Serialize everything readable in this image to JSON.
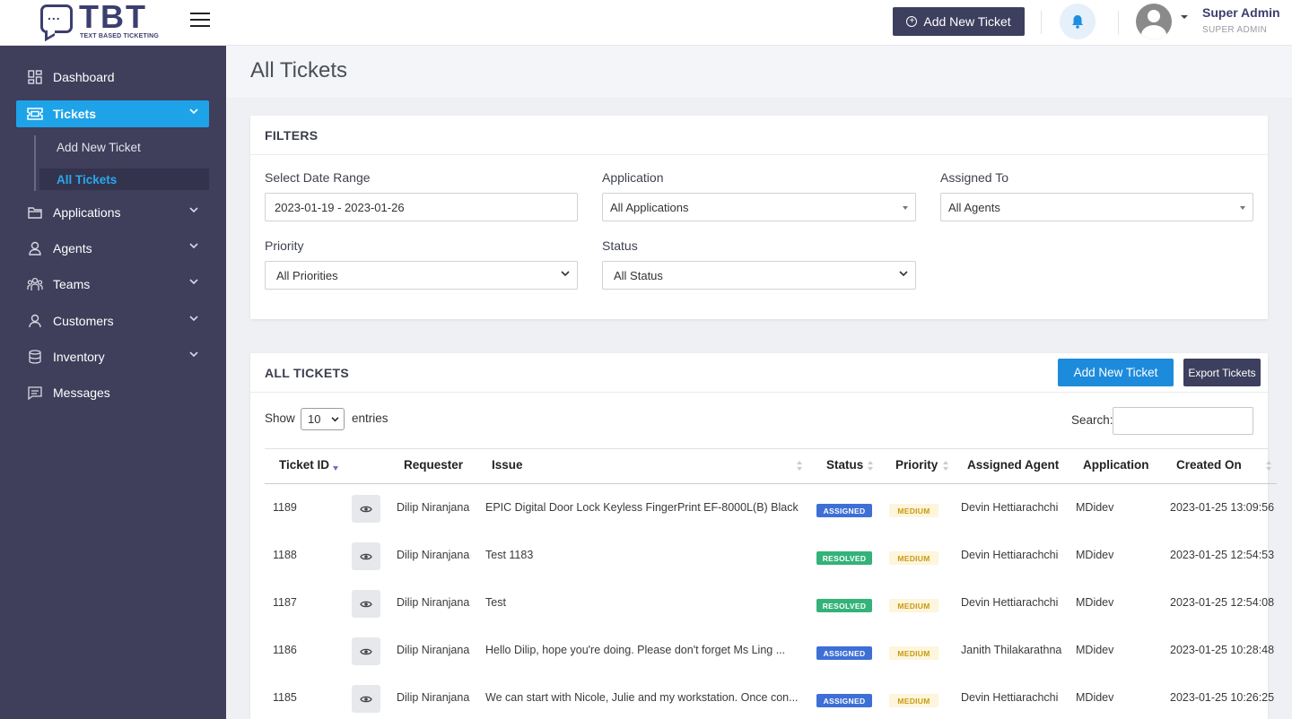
{
  "brand": {
    "name": "TBT",
    "tagline": "TEXT BASED TICKETING",
    "dots": "..."
  },
  "topbar": {
    "add_ticket_label": "Add New Ticket",
    "user_name": "Super Admin",
    "user_role": "SUPER ADMIN"
  },
  "sidebar": {
    "items": [
      {
        "label": "Dashboard",
        "icon": "dashboard-icon"
      },
      {
        "label": "Tickets",
        "icon": "ticket-icon",
        "active": true
      },
      {
        "label": "Applications",
        "icon": "folder-icon"
      },
      {
        "label": "Agents",
        "icon": "user-icon"
      },
      {
        "label": "Teams",
        "icon": "team-icon"
      },
      {
        "label": "Customers",
        "icon": "user-icon"
      },
      {
        "label": "Inventory",
        "icon": "database-icon"
      },
      {
        "label": "Messages",
        "icon": "message-icon"
      }
    ],
    "ticket_sub": [
      {
        "label": "Add New Ticket"
      },
      {
        "label": "All Tickets",
        "active": true
      }
    ]
  },
  "page": {
    "title": "All Tickets"
  },
  "filters": {
    "title": "FILTERS",
    "date_range_label": "Select Date Range",
    "date_range_value": "2023-01-19 - 2023-01-26",
    "application_label": "Application",
    "application_value": "All Applications",
    "assigned_label": "Assigned To",
    "assigned_value": "All Agents",
    "priority_label": "Priority",
    "priority_value": "All Priorities",
    "status_label": "Status",
    "status_value": "All Status"
  },
  "tickets": {
    "title": "ALL TICKETS",
    "add_label": "Add New Ticket",
    "export_label": "Export Tickets",
    "show_label": "Show",
    "entries_value": "10",
    "entries_label": "entries",
    "search_label": "Search:",
    "columns": {
      "id": "Ticket ID",
      "requester": "Requester",
      "issue": "Issue",
      "status": "Status",
      "priority": "Priority",
      "agent": "Assigned Agent",
      "application": "Application",
      "created": "Created On"
    },
    "rows": [
      {
        "id": "1189",
        "requester": "Dilip Niranjana",
        "issue": "EPIC Digital Door Lock Keyless FingerPrint EF-8000L(B) Black",
        "status": "ASSIGNED",
        "priority": "MEDIUM",
        "agent": "Devin Hettiarachchi",
        "application": "MDidev",
        "created": "2023-01-25 13:09:56"
      },
      {
        "id": "1188",
        "requester": "Dilip Niranjana",
        "issue": "Test 1183",
        "status": "RESOLVED",
        "priority": "MEDIUM",
        "agent": "Devin Hettiarachchi",
        "application": "MDidev",
        "created": "2023-01-25 12:54:53"
      },
      {
        "id": "1187",
        "requester": "Dilip Niranjana",
        "issue": "Test",
        "status": "RESOLVED",
        "priority": "MEDIUM",
        "agent": "Devin Hettiarachchi",
        "application": "MDidev",
        "created": "2023-01-25 12:54:08"
      },
      {
        "id": "1186",
        "requester": "Dilip Niranjana",
        "issue": "Hello Dilip, hope you're doing. Please don't forget Ms Ling ...",
        "status": "ASSIGNED",
        "priority": "MEDIUM",
        "agent": "Janith Thilakarathna",
        "application": "MDidev",
        "created": "2023-01-25 10:28:48"
      },
      {
        "id": "1185",
        "requester": "Dilip Niranjana",
        "issue": "We can start with Nicole, Julie and my workstation. Once con...",
        "status": "ASSIGNED",
        "priority": "MEDIUM",
        "agent": "Devin Hettiarachchi",
        "application": "MDidev",
        "created": "2023-01-25 10:26:25"
      }
    ]
  },
  "colors": {
    "sidebar": "#3f3e5b",
    "accent": "#1ea3e9",
    "assigned": "#3d6fd6",
    "resolved": "#34b27a",
    "medium_bg": "#fdf5dc",
    "medium_text": "#c99a12"
  }
}
